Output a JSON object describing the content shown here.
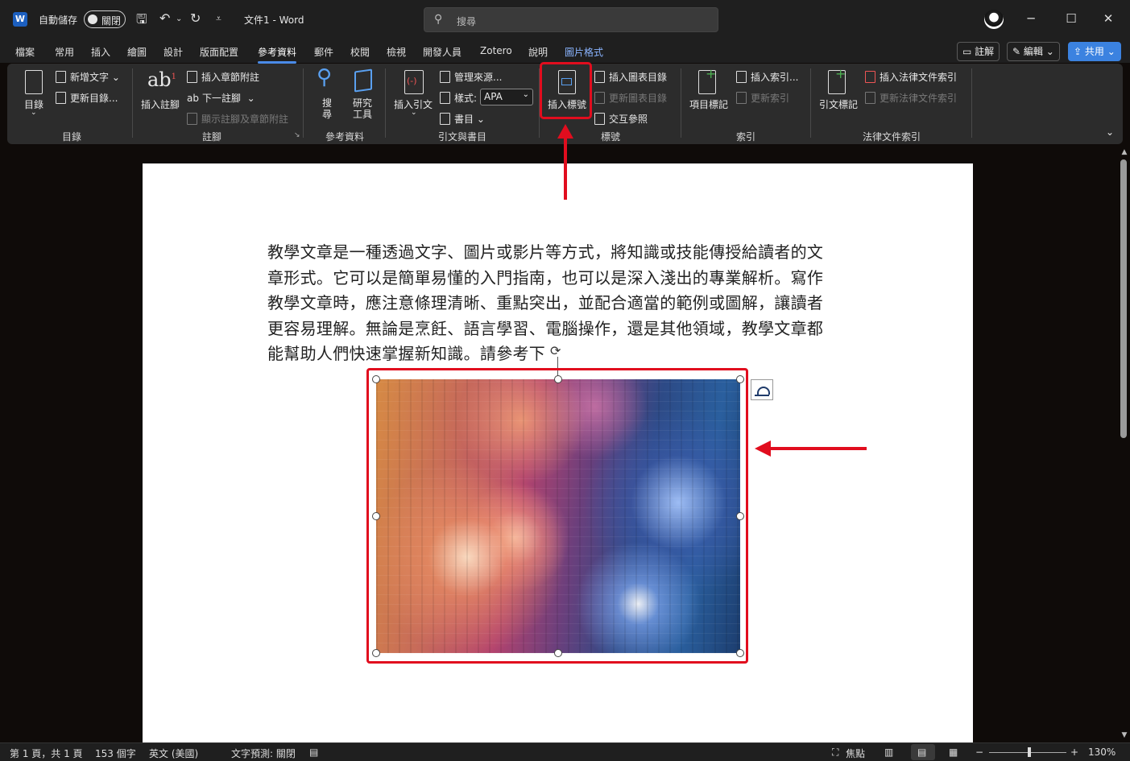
{
  "titlebar": {
    "app_icon_letter": "W",
    "autosave_label": "自動儲存",
    "autosave_state": "關閉",
    "doc_title": "文件1 - Word",
    "search_placeholder": "搜尋",
    "icons": [
      "save-icon",
      "undo-icon",
      "redo-icon",
      "customize-icon"
    ],
    "window_controls": [
      "─",
      "☐",
      "✕"
    ]
  },
  "menu": {
    "tabs": [
      "檔案",
      "常用",
      "插入",
      "繪圖",
      "設計",
      "版面配置",
      "參考資料",
      "郵件",
      "校閱",
      "檢視",
      "開發人員",
      "Zotero",
      "說明",
      "圖片格式"
    ],
    "active_tab": "參考資料",
    "comments_button": "註解",
    "editing_button": "編輯",
    "share_button": "共用"
  },
  "ribbon": {
    "toc": {
      "big": "目錄",
      "add_text": "新增文字",
      "update_toc": "更新目錄...",
      "group": "目錄"
    },
    "footnotes": {
      "big": "插入註腳",
      "insert_endnote": "插入章節附註",
      "next_footnote": "下一註腳",
      "show_notes": "顯示註腳及章節附註",
      "group": "註腳"
    },
    "research": {
      "search": "搜\n尋",
      "researcher": "研究\n工具",
      "group": "參考資料"
    },
    "citations": {
      "big": "插入引文",
      "manage_sources": "管理來源...",
      "style_label": "樣式:",
      "style_value": "APA",
      "bibliography": "書目",
      "group": "引文與書目"
    },
    "captions": {
      "big": "插入標號",
      "insert_table_of_figures": "插入圖表目錄",
      "update_table": "更新圖表目錄",
      "cross_reference": "交互參照",
      "group": "標號"
    },
    "index": {
      "big": "項目標記",
      "insert_index": "插入索引...",
      "update_index": "更新索引",
      "group": "索引"
    },
    "authorities": {
      "big": "引文標記",
      "insert_table": "插入法律文件索引",
      "update_table": "更新法律文件索引",
      "group": "法律文件索引"
    }
  },
  "document": {
    "paragraph_lines": [
      "教學文章是一種透過文字、圖片或影片等方式，將知識或技能傳授給讀者的文",
      "章形式。它可以是簡單易懂的入門指南，也可以是深入淺出的專業解析。寫作",
      "教學文章時，應注意條理清晰、重點突出，並配合適當的範例或圖解，讓讀者",
      "更容易理解。無論是烹飪、語言學習、電腦操作，還是其他領域，教學文章都",
      "能幫助人們快速掌握新知識。請參考下"
    ]
  },
  "statusbar": {
    "page": "第 1 頁，共 1 頁",
    "words": "153 個字",
    "language": "英文 (美國)",
    "text_predictions": "文字預測: 關閉",
    "focus": "焦點",
    "zoom": "130%",
    "minus": "−",
    "plus": "+"
  },
  "colors": {
    "highlight": "#e10d1e",
    "accent": "#4a8be8"
  }
}
